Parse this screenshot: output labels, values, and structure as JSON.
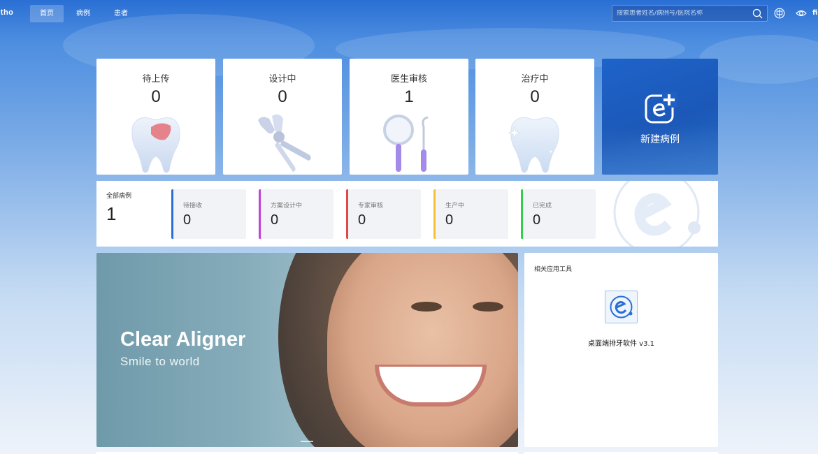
{
  "brand": {
    "logo_text": "rtho"
  },
  "nav": {
    "items": [
      {
        "label": "首页",
        "active": true
      },
      {
        "label": "病例",
        "active": false
      },
      {
        "label": "患者",
        "active": false
      }
    ],
    "search_placeholder": "搜索患者姓名/病例号/医院名称",
    "cut_text": "fi"
  },
  "status_cards": [
    {
      "title": "待上传",
      "count": "0",
      "icon": "tooth-icon"
    },
    {
      "title": "设计中",
      "count": "0",
      "icon": "pliers-icon"
    },
    {
      "title": "医生审核",
      "count": "1",
      "icon": "dental-mirror-icon"
    },
    {
      "title": "治疗中",
      "count": "0",
      "icon": "sparkle-tooth-icon"
    }
  ],
  "new_case": {
    "label": "新建病例",
    "icon": "add-case-icon"
  },
  "summary": {
    "all_label": "全部病例",
    "all_count": "1",
    "items": [
      {
        "label": "待接收",
        "count": "0",
        "color": "#2a6fd4"
      },
      {
        "label": "方案设计中",
        "count": "0",
        "color": "#c23fe0"
      },
      {
        "label": "专家审核",
        "count": "0",
        "color": "#e04848"
      },
      {
        "label": "生产中",
        "count": "0",
        "color": "#f2c23a"
      },
      {
        "label": "已完成",
        "count": "0",
        "color": "#2fd14a"
      }
    ]
  },
  "banner": {
    "title": "Clear Aligner",
    "subtitle": "Smile to world"
  },
  "tools": {
    "title": "相关应用工具",
    "apps": [
      {
        "label": "桌面端排牙软件 v3.1",
        "icon": "e-app-icon"
      }
    ]
  },
  "colors": {
    "primary": "#2a6fd4",
    "header": "#2a6fd4"
  }
}
